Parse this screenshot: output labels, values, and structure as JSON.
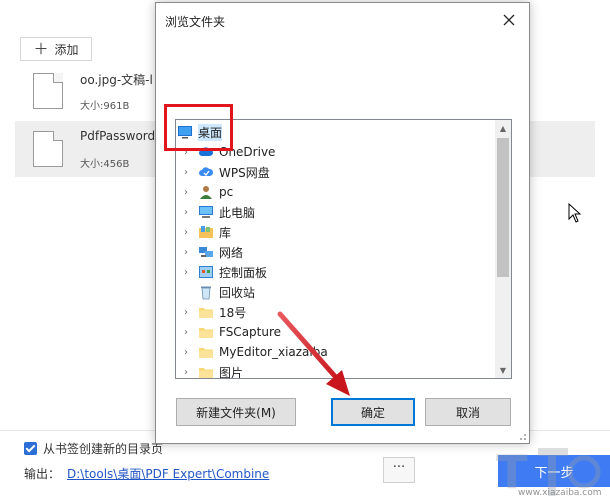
{
  "app": {
    "add_label": "添加",
    "files": [
      {
        "name": "oo.jpg-文稿-l",
        "size": "大小:961B"
      },
      {
        "name": "PdfPassword",
        "size": "大小:456B"
      }
    ],
    "bookmark_label": "从书签创建新的目录页",
    "output_label": "输出：",
    "output_path": "D:\\tools\\桌面\\PDF Expert\\Combine",
    "more_label": "···",
    "next_label": "下一步",
    "watermark_text": "www.xiazaiba.com"
  },
  "dialog": {
    "title": "浏览文件夹",
    "tree": [
      {
        "label": "桌面",
        "icon": "desktop-icon",
        "expandable": false,
        "root": true
      },
      {
        "label": "OneDrive",
        "icon": "cloud-icon",
        "expandable": true
      },
      {
        "label": "WPS网盘",
        "icon": "wps-cloud-icon",
        "expandable": true
      },
      {
        "label": "pc",
        "icon": "user-icon",
        "expandable": true
      },
      {
        "label": "此电脑",
        "icon": "computer-icon",
        "expandable": true
      },
      {
        "label": "库",
        "icon": "library-icon",
        "expandable": true
      },
      {
        "label": "网络",
        "icon": "network-icon",
        "expandable": true
      },
      {
        "label": "控制面板",
        "icon": "control-panel-icon",
        "expandable": true
      },
      {
        "label": "回收站",
        "icon": "recycle-bin-icon",
        "expandable": false
      },
      {
        "label": "18号",
        "icon": "folder-icon",
        "expandable": true
      },
      {
        "label": "FSCapture",
        "icon": "folder-icon",
        "expandable": true
      },
      {
        "label": "MyEditor_xiazaiba",
        "icon": "folder-icon",
        "expandable": true
      },
      {
        "label": "图片",
        "icon": "folder-icon",
        "expandable": true
      }
    ],
    "new_folder_label": "新建文件夹(M)",
    "ok_label": "确定",
    "cancel_label": "取消"
  },
  "colors": {
    "accent": "#3f7cf3",
    "annotation": "#e0161c",
    "selection": "#cde8ff",
    "link": "#2357c6"
  }
}
